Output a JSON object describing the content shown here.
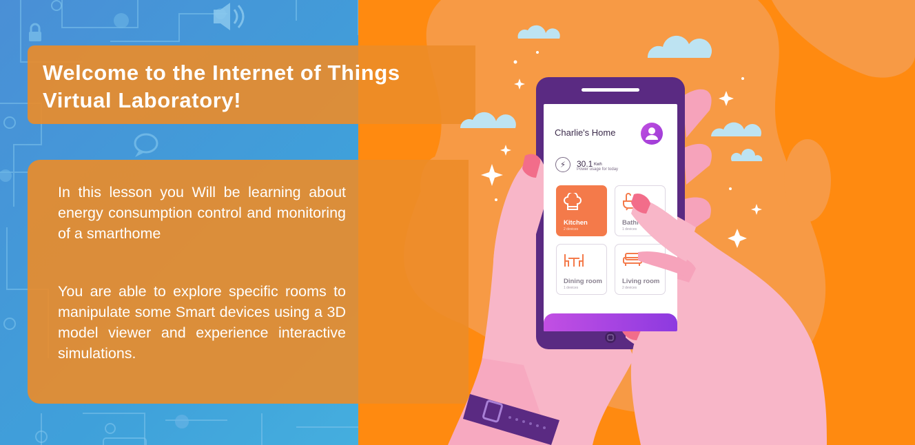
{
  "title": "Welcome to the Internet of Things Virtual Laboratory!",
  "paragraphs": [
    "In this lesson you Will be learning about energy consumption control and monitoring of a smarthome",
    "You are able to explore specific rooms to manipulate some Smart devices using a 3D model viewer and experience interactive simulations."
  ],
  "phone": {
    "home_title": "Charlie's Home",
    "power_value": "30.1",
    "power_unit": "Kwh",
    "power_caption": "Power usage for today",
    "rooms": [
      {
        "name": "Kitchen",
        "devices": "2 devices",
        "active": true,
        "icon": "chef-hat-icon"
      },
      {
        "name": "Bathroom",
        "devices": "1 devices",
        "active": false,
        "icon": "bathtub-icon"
      },
      {
        "name": "Dining room",
        "devices": "1 devices",
        "active": false,
        "icon": "dining-table-icon"
      },
      {
        "name": "Living room",
        "devices": "2 devices",
        "active": false,
        "icon": "sofa-icon"
      }
    ]
  },
  "colors": {
    "orange_bg": "#ff8a10",
    "panel_orange": "#ec8c28",
    "circuit_blue": "#3fa0da",
    "phone_purple": "#5a2a82",
    "accent_pink": "#f7a9c0"
  }
}
